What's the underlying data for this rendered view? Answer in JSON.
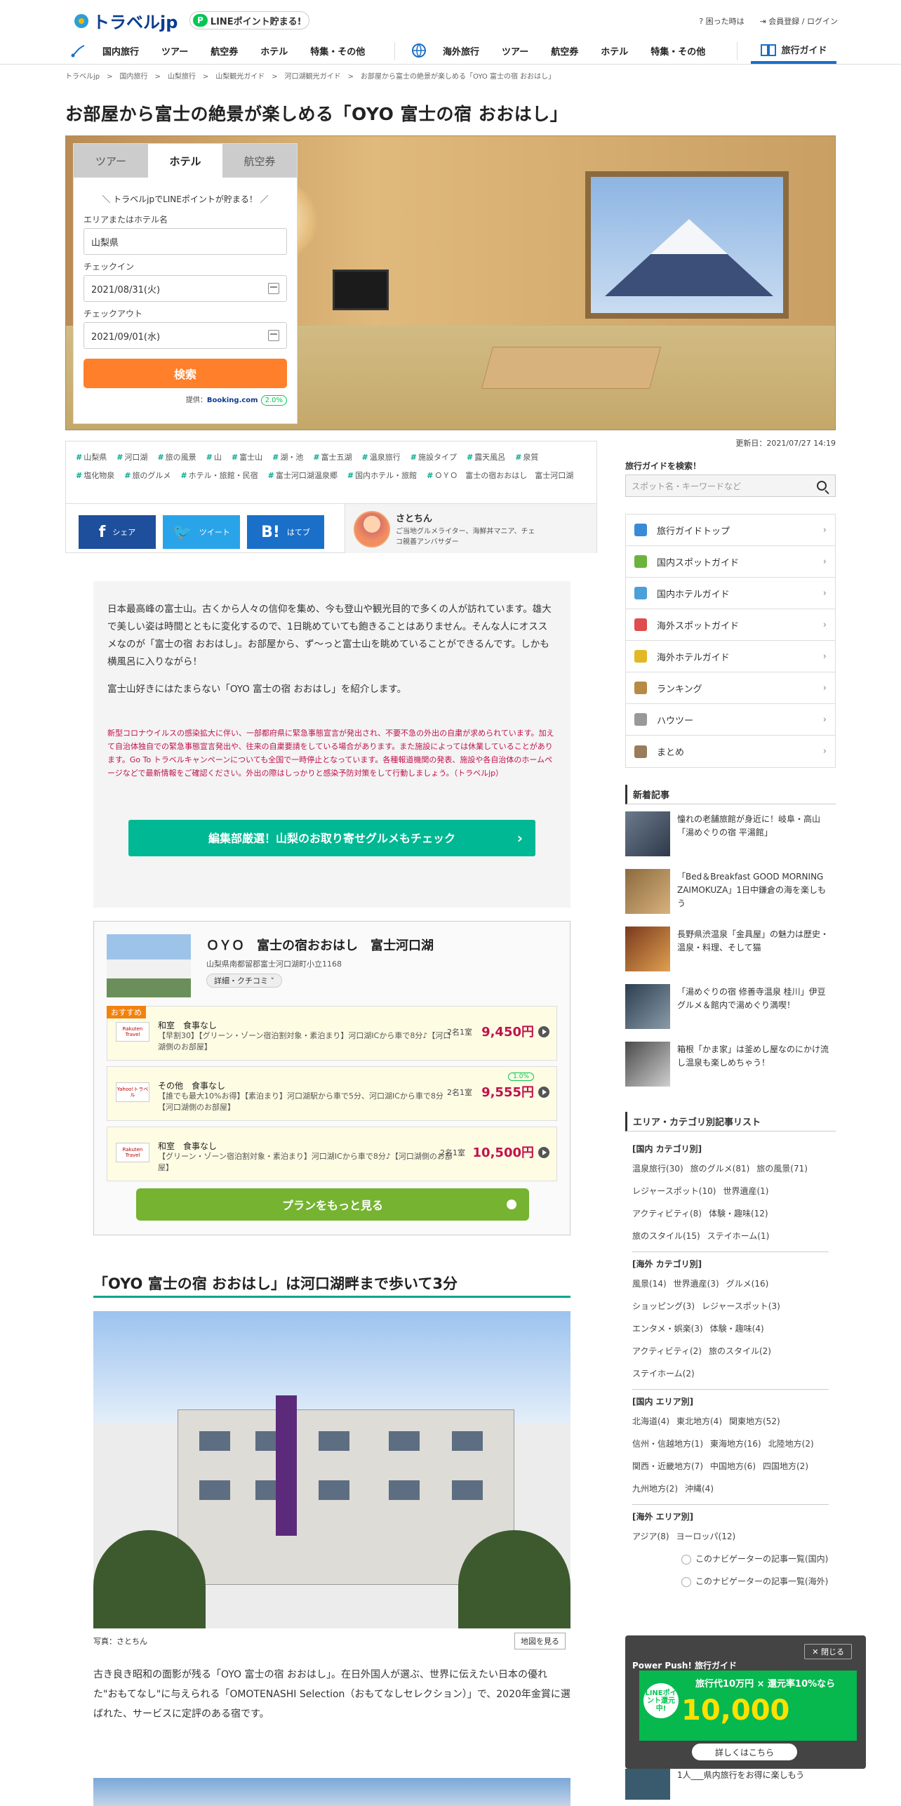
{
  "header": {
    "logo": "トラベルjp",
    "line_badge": "LINEポイント貯まる!",
    "help": "困った時は",
    "login": "会員登録 / ログイン"
  },
  "nav": {
    "domestic": [
      "国内旅行",
      "ツアー",
      "航空券",
      "ホテル",
      "特集・その他"
    ],
    "overseas": [
      "海外旅行",
      "ツアー",
      "航空券",
      "ホテル",
      "特集・その他"
    ],
    "guide": "旅行ガイド"
  },
  "breadcrumb": "トラベルjp　>　国内旅行　>　山梨旅行　>　山梨観光ガイド　>　河口湖観光ガイド　>　お部屋から富士の絶景が楽しめる「OYO 富士の宿 おおはし」",
  "title": "お部屋から富士の絶景が楽しめる「OYO 富士の宿 おおはし」",
  "search": {
    "tabs": [
      "ツアー",
      "ホテル",
      "航空券"
    ],
    "promo": "＼ トラベルjpでLINEポイントが貯まる！ ／",
    "area_label": "エリアまたはホテル名",
    "area_value": "山梨県",
    "checkin_label": "チェックイン",
    "checkin_value": "2021/08/31(火)",
    "checkout_label": "チェックアウト",
    "checkout_value": "2021/09/01(水)",
    "button": "検索",
    "provider_prefix": "提供：",
    "provider": "Booking.com",
    "point": "2.0%"
  },
  "updated": "更新日：2021/07/27 14:19",
  "tags": [
    "山梨県",
    "河口湖",
    "旅の風景",
    "山",
    "富士山",
    "湖・池",
    "富士五湖",
    "温泉旅行",
    "施設タイプ",
    "露天風呂",
    "泉質",
    "塩化物泉",
    "旅のグルメ",
    "ホテル・旅館・民宿",
    "富士河口湖温泉郷",
    "国内ホテル・旅館",
    "ＯＹＯ　富士の宿おおはし　富士河口湖"
  ],
  "share": {
    "fb_glyph": "f",
    "fb": "シェア",
    "tw_glyph": "🐦",
    "tw": "ツイート",
    "hb_glyph": "B!",
    "hb": "はてブ"
  },
  "author": {
    "name": "さとちん",
    "desc": "ご当地グルメライター、海鮮丼マニア、チェコ親善アンバサダー"
  },
  "intro": {
    "p1": "日本最高峰の富士山。古くから人々の信仰を集め、今も登山や観光目的で多くの人が訪れています。雄大で美しい姿は時間とともに変化するので、1日眺めていても飽きることはありません。そんな人にオススメなのが「富士の宿 おおはし」。お部屋から、ず～っと富士山を眺めていることができるんです。しかも横風呂に入りながら！",
    "p2": "富士山好きにはたまらない「OYO 富士の宿 おおはし」を紹介します。",
    "warning": "新型コロナウイルスの感染拡大に伴い、一部都府県に緊急事態宣言が発出され、不要不急の外出の自粛が求められています。加えて自治体独自での緊急事態宣言発出や、往来の自粛要請をしている場合があります。また施設によっては休業していることがあります。Go To トラベルキャンペーンについても全国で一時停止となっています。各種報道機関の発表、施設や各自治体のホームページなどで最新情報をご確認ください。外出の際はしっかりと感染予防対策をして行動しましょう。（トラベルjp）",
    "button": "編集部厳選！山梨のお取り寄せグルメもチェック"
  },
  "hotel": {
    "name": "ＯＹＯ　富士の宿おおはし　富士河口湖",
    "address": "山梨県南都留郡富士河口湖町小立1168",
    "reviews": "詳細・クチコミ ˅",
    "recommend": "おすすめ",
    "plans": [
      {
        "logo": "Rakuten Travel",
        "title": "和室　食事なし",
        "desc": "【早割30】【グリーン・ゾーン宿泊割対象・素泊まり】河口湖ICから車で8分♪【河口湖側のお部屋】",
        "people": "2名1室",
        "price": "9,450円",
        "badge": ""
      },
      {
        "logo": "Yahoo!トラベル",
        "title": "その他　食事なし",
        "desc": "【誰でも最大10%お得】【素泊まり】河口湖駅から車で5分、河口湖ICから車で8分【河口湖側のお部屋】",
        "people": "2名1室",
        "price": "9,555円",
        "badge": "1.0%"
      },
      {
        "logo": "Rakuten Travel",
        "title": "和室　食事なし",
        "desc": "【グリーン・ゾーン宿泊割対象・素泊まり】河口湖ICから車で8分♪【河口湖側のお部屋】",
        "people": "2名1室",
        "price": "10,500円",
        "badge": ""
      }
    ],
    "more": "プランをもっと見る"
  },
  "section": {
    "heading": "「OYO 富士の宿 おおはし」は河口湖畔まで歩いて3分",
    "caption": "写真：さとちん",
    "map": "地図を見る",
    "body": "古き良き昭和の面影が残る「OYO 富士の宿 おおはし」。在日外国人が選ぶ、世界に伝えたい日本の優れた\"おもてなし\"に与えられる「OMOTENASHI Selection（おもてなしセレクション）」で、2020年金賞に選ばれた、サービスに定評のある宿です。"
  },
  "sidebar": {
    "search_label": "旅行ガイドを検索！",
    "search_placeholder": "スポット名・キーワードなど",
    "menu": [
      "旅行ガイドトップ",
      "国内スポットガイド",
      "国内ホテルガイド",
      "海外スポットガイド",
      "海外ホテルガイド",
      "ランキング",
      "ハウツー",
      "まとめ"
    ],
    "new_heading": "新着記事",
    "news": [
      "憧れの老舗旅館が身近に！岐阜・高山「湯めぐりの宿 平湯館」",
      "「Bed＆Breakfast GOOD MORNING ZAIMOKUZA」1日中鎌倉の海を楽しもう",
      "長野県渋温泉「金具屋」の魅力は歴史・温泉・料理、そして猫",
      "「湯めぐりの宿 修善寺温泉 桂川」伊豆グルメ＆館内で湯めぐり満喫！",
      "箱根「かま家」は釜めし屋なのにかけ流し温泉も楽しめちゃう！"
    ],
    "cat_heading": "エリア・カテゴリ別記事リスト",
    "cats": [
      {
        "h": "[国内 カテゴリ別]",
        "items": [
          "温泉旅行(30)",
          "旅のグルメ(81)",
          "旅の風景(71)",
          "レジャースポット(10)",
          "世界遺産(1)",
          "アクティビティ(8)",
          "体験・趣味(12)",
          "旅のスタイル(15)",
          "ステイホーム(1)"
        ]
      },
      {
        "h": "[海外 カテゴリ別]",
        "items": [
          "風景(14)",
          "世界遺産(3)",
          "グルメ(16)",
          "ショッピング(3)",
          "レジャースポット(3)",
          "エンタメ・娯楽(3)",
          "体験・趣味(4)",
          "アクティビティ(2)",
          "旅のスタイル(2)",
          "ステイホーム(2)"
        ]
      },
      {
        "h": "[国内 エリア別]",
        "items": [
          "北海道(4)",
          "東北地方(4)",
          "関東地方(52)",
          "信州・信越地方(1)",
          "東海地方(16)",
          "北陸地方(2)",
          "関西・近畿地方(7)",
          "中国地方(6)",
          "四国地方(2)",
          "九州地方(2)",
          "沖縄(4)"
        ]
      },
      {
        "h": "[海外 エリア別]",
        "items": [
          "アジア(8)",
          "ヨーロッパ(12)"
        ]
      }
    ],
    "nav_links": [
      "このナビゲーターの記事一覧(国内)",
      "このナビゲーターの記事一覧(海外)"
    ]
  },
  "popup": {
    "close": "✕ 閉じる",
    "heading": "Power Push! 旅行ガイド",
    "line_circle": "LINEポイント還元中!",
    "top": "旅行代10万円 × 還元率10%なら",
    "big": "10,000",
    "more": "詳しくはこちら",
    "below_text": "1人___県内旅行をお得に楽しもう"
  }
}
